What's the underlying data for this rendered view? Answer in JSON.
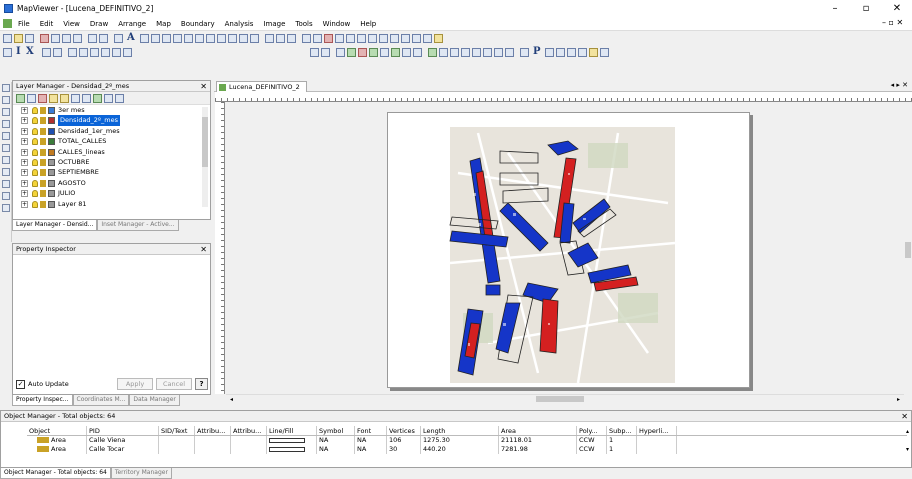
{
  "window": {
    "title": "MapViewer - [Lucena_DEFINITIVO_2]",
    "minimize": "–",
    "maximize": "▫",
    "close": "✕"
  },
  "menu": {
    "items": [
      "File",
      "Edit",
      "View",
      "Draw",
      "Arrange",
      "Map",
      "Boundary",
      "Analysis",
      "Image",
      "Tools",
      "Window",
      "Help"
    ],
    "mdi_controls": "– ▫ ✕"
  },
  "toolbar2": {
    "text_a": "A"
  },
  "toolbar3": {
    "text_i": "I",
    "text_x": "X",
    "text_p": "P"
  },
  "layer_manager": {
    "title": "Layer Manager - Densidad_2º_mes",
    "close": "✕",
    "layers": [
      {
        "name": "3er mes",
        "selected": false,
        "icon_color": "#3a7bd5"
      },
      {
        "name": "Densidad_2º_mes",
        "selected": true,
        "icon_color": "#b03030"
      },
      {
        "name": "Densidad_1er_mes",
        "selected": false,
        "icon_color": "#2050b0"
      },
      {
        "name": "TOTAL_CALLES",
        "selected": false,
        "icon_color": "#3c7d3c"
      },
      {
        "name": "CALLES_lineas",
        "selected": false,
        "icon_color": "#c07a20"
      },
      {
        "name": "OCTUBRE",
        "selected": false,
        "icon_color": "#999999"
      },
      {
        "name": "SEPTIEMBRE",
        "selected": false,
        "icon_color": "#999999"
      },
      {
        "name": "AGOSTO",
        "selected": false,
        "icon_color": "#999999"
      },
      {
        "name": "JULIO",
        "selected": false,
        "icon_color": "#999999"
      },
      {
        "name": "Layer 81",
        "selected": false,
        "icon_color": "#999999"
      }
    ],
    "tabs": [
      "Layer Manager - Densid...",
      "Inset Manager - Active..."
    ]
  },
  "property_inspector": {
    "title": "Property Inspector",
    "close": "✕",
    "auto_update_label": "Auto Update",
    "apply_label": "Apply",
    "cancel_label": "Cancel",
    "help_label": "?",
    "tabs": [
      "Property Inspec...",
      "Coordinates M...",
      "Data Manager"
    ]
  },
  "document": {
    "tab_label": "Lucena_DEFINITIVO_2",
    "tab_nav": "◂ ▸ ✕"
  },
  "object_manager": {
    "title": "Object Manager - Total objects: 64",
    "close": "✕",
    "columns": [
      "Object",
      "PID",
      "SID/Text",
      "Attribu...",
      "Attribu...",
      "Line/Fill",
      "Symbol",
      "Font",
      "Vertices",
      "Length",
      "Area",
      "Poly...",
      "Subp...",
      "Hyperli..."
    ],
    "rows": [
      {
        "object": "Area",
        "pid": "Calle Viena",
        "sid": "",
        "a1": "",
        "a2": "",
        "symbol": "NA",
        "font": "NA",
        "vertices": "106",
        "length": "1275.30",
        "area": "21118.01",
        "poly": "CCW",
        "subp": "1",
        "hyper": ""
      },
      {
        "object": "Area",
        "pid": "Calle Tocar",
        "sid": "",
        "a1": "",
        "a2": "",
        "symbol": "NA",
        "font": "NA",
        "vertices": "30",
        "length": "440.20",
        "area": "7281.98",
        "poly": "CCW",
        "subp": "1",
        "hyper": ""
      }
    ],
    "tabs": [
      "Object Manager - Total objects: 64",
      "Territory Manager"
    ]
  },
  "colors": {
    "selection": "#0a64d8",
    "density_red": "#d42020",
    "density_blue": "#1535c8",
    "map_base": "#e8e4dc"
  }
}
